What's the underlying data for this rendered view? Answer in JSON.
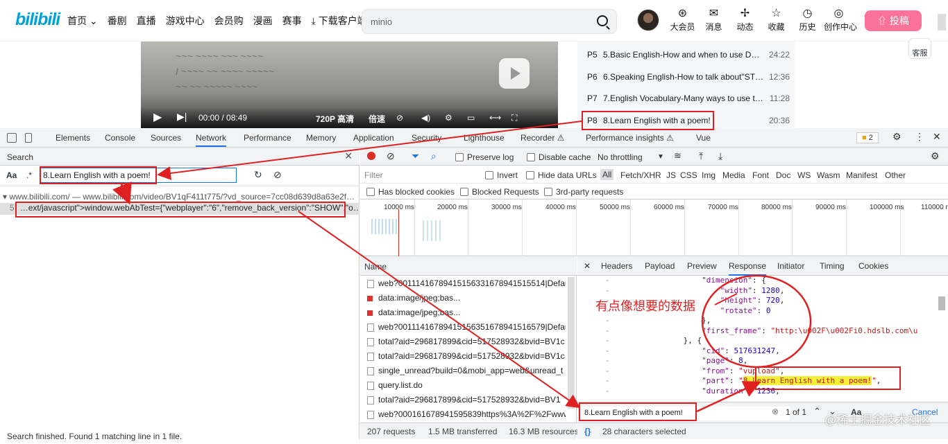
{
  "bili": {
    "logo": "bilibili",
    "nav": [
      "首页 ⌄",
      "番剧",
      "直播",
      "游戏中心",
      "会员购",
      "漫画",
      "赛事",
      "⤓ 下载客户端"
    ],
    "search_query": "minio",
    "header_icons": [
      {
        "glyph": "⊛",
        "label": "大会员"
      },
      {
        "glyph": "✉",
        "label": "消息"
      },
      {
        "glyph": "✢",
        "label": "动态"
      },
      {
        "glyph": "☆",
        "label": "收藏"
      },
      {
        "glyph": "◷",
        "label": "历史"
      },
      {
        "glyph": "◎",
        "label": "创作中心"
      }
    ],
    "upload_label": "⇧ 投稿",
    "kefu": "客服"
  },
  "video": {
    "time": "00:00 / 08:49",
    "quality": "720P 高清",
    "speed": "倍速"
  },
  "playlist": [
    {
      "p": "P5",
      "title": "5.Basic English-How and when to use DO,…",
      "dur": "24:22"
    },
    {
      "p": "P6",
      "title": "6.Speaking English-How to talk about\"STR…",
      "dur": "12:36"
    },
    {
      "p": "P7",
      "title": "7.English Vocabulary-Many ways to use th…",
      "dur": "11:28"
    },
    {
      "p": "P8",
      "title": "8.Learn English with a poem!",
      "dur": "20:36"
    }
  ],
  "devtools": {
    "tabs": [
      "Elements",
      "Console",
      "Sources",
      "Network",
      "Performance",
      "Memory",
      "Application",
      "Security",
      "Lighthouse",
      "Recorder ⚠",
      "Performance insights ⚠",
      "Vue"
    ],
    "active_tab": "Network",
    "warning_count": "2"
  },
  "search_pane": {
    "title": "Search",
    "aa": "Aa",
    "regex": ".*",
    "query": "8.Learn English with a poem!",
    "result_file": "www.bilibili.com/ — www.bilibili.com/video/BV1qF411t775/?vd_source=7cc08d639d8a63e2f…",
    "result_line_no": "5",
    "result_line": "…ext/javascript\">window.webAbTest={\"webplayer\":\"6\",\"remove_back_version\":\"SHOW\",\"o…",
    "footer": "Search finished.  Found 1 matching line in 1 file."
  },
  "network": {
    "preserve_log": "Preserve log",
    "disable_cache": "Disable cache",
    "throttling": "No throttling",
    "filter_placeholder": "Filter",
    "invert": "Invert",
    "hide_data_urls": "Hide data URLs",
    "types": [
      "All",
      "Fetch/XHR",
      "JS",
      "CSS",
      "Img",
      "Media",
      "Font",
      "Doc",
      "WS",
      "Wasm",
      "Manifest",
      "Other"
    ],
    "has_blocked": "Has blocked cookies",
    "blocked_requests": "Blocked Requests",
    "third_party": "3rd-party requests",
    "ticks": [
      "10000 ms",
      "20000 ms",
      "30000 ms",
      "40000 ms",
      "50000 ms",
      "60000 ms",
      "70000 ms",
      "80000 ms",
      "90000 ms",
      "100000 ms",
      "110000 m"
    ],
    "name_header": "Name",
    "rows": [
      {
        "name": "web?00111416789415156331678941515514|Defau",
        "type": "doc"
      },
      {
        "name": "data:image/jpeg;bas...",
        "type": "img"
      },
      {
        "name": "data:image/jpeg;bas...",
        "type": "img"
      },
      {
        "name": "web?00111416789415156351678941516579|Defau",
        "type": "doc"
      },
      {
        "name": "total?aid=296817899&cid=517528932&bvid=BV1c",
        "type": "doc"
      },
      {
        "name": "total?aid=296817899&cid=517528932&bvid=BV1c",
        "type": "doc"
      },
      {
        "name": "single_unread?build=0&mobi_app=web&unread_t",
        "type": "doc"
      },
      {
        "name": "query.list.do",
        "type": "doc"
      },
      {
        "name": "total?aid=296817899&cid=517528932&bvid=BV1",
        "type": "doc"
      },
      {
        "name": "web?00016167894159583​9https%3A%2F%2Fwww",
        "type": "doc"
      }
    ],
    "status": {
      "requests": "207 requests",
      "transferred": "1.5 MB transferred",
      "resources": "16.3 MB resources"
    }
  },
  "response": {
    "tabs": [
      "Headers",
      "Payload",
      "Preview",
      "Response",
      "Initiator",
      "Timing",
      "Cookies"
    ],
    "active_tab": "Response",
    "find_query": "8.Learn English with a poem!",
    "find_count": "1 of 1",
    "find_aa": "Aa",
    "cancel": "Cancel",
    "status": "28 characters selected"
  },
  "annotation": {
    "note": "有点像想要的数据",
    "watermark": "@稀土掘金技术社区"
  }
}
